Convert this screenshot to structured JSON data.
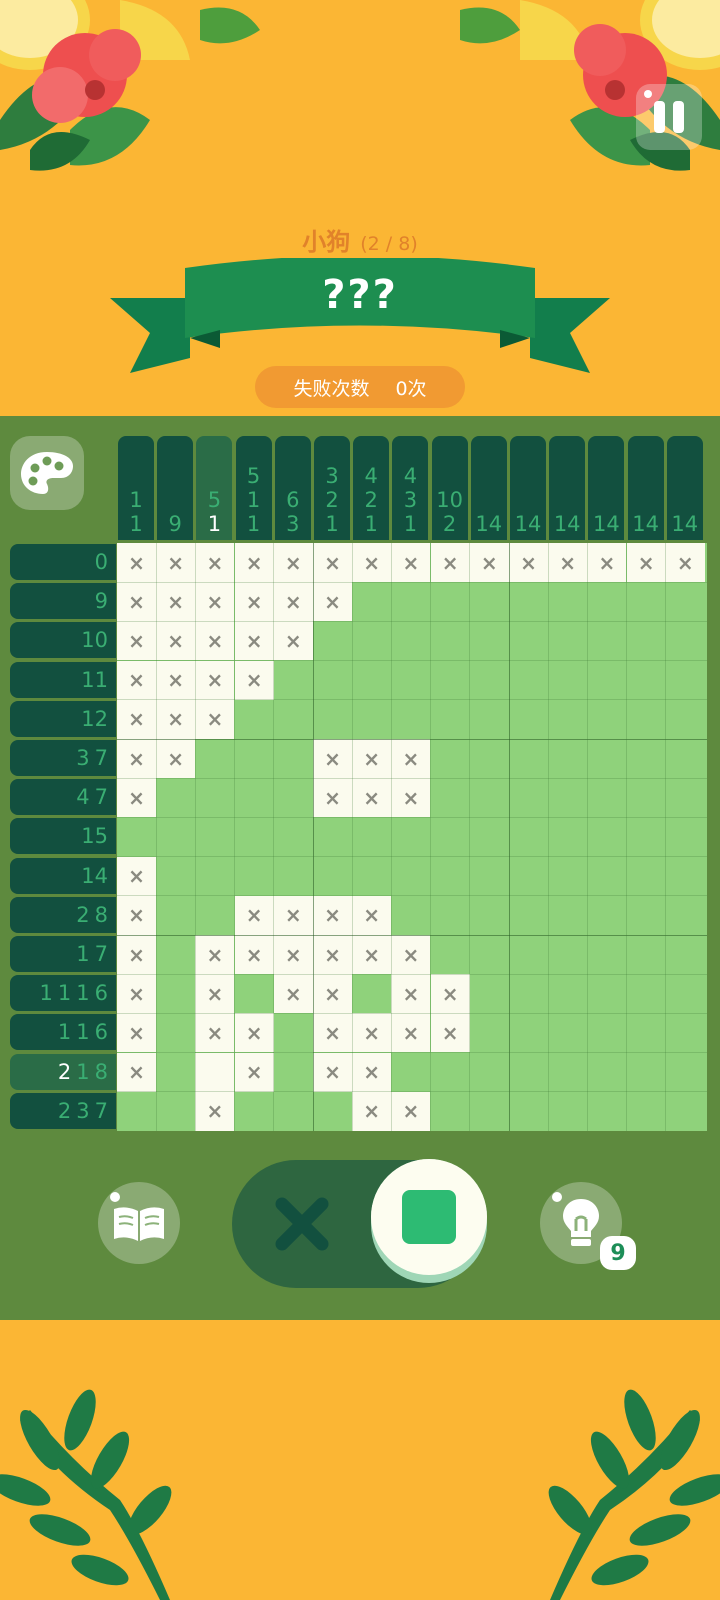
{
  "header": {
    "puzzle_name": "小狗",
    "progress": "(2 / 8)",
    "answer": "???",
    "fail_label": "失败次数",
    "fail_count": "0次"
  },
  "hint_count": "9",
  "col_clues": [
    [
      {
        "t": "1",
        "w": false
      },
      {
        "t": "1",
        "w": false
      }
    ],
    [
      {
        "t": "9",
        "w": false
      }
    ],
    [
      {
        "t": "5",
        "w": false
      },
      {
        "t": "1",
        "w": true
      }
    ],
    [
      {
        "t": "5",
        "w": false
      },
      {
        "t": "1",
        "w": false
      },
      {
        "t": "1",
        "w": false
      }
    ],
    [
      {
        "t": "6",
        "w": false
      },
      {
        "t": "3",
        "w": false
      }
    ],
    [
      {
        "t": "3",
        "w": false
      },
      {
        "t": "2",
        "w": false
      },
      {
        "t": "1",
        "w": false
      }
    ],
    [
      {
        "t": "4",
        "w": false
      },
      {
        "t": "2",
        "w": false
      },
      {
        "t": "1",
        "w": false
      }
    ],
    [
      {
        "t": "4",
        "w": false
      },
      {
        "t": "3",
        "w": false
      },
      {
        "t": "1",
        "w": false
      }
    ],
    [
      {
        "t": "10",
        "w": false
      },
      {
        "t": "2",
        "w": false
      }
    ],
    [
      {
        "t": "14",
        "w": false
      }
    ],
    [
      {
        "t": "14",
        "w": false
      }
    ],
    [
      {
        "t": "14",
        "w": false
      }
    ],
    [
      {
        "t": "14",
        "w": false
      }
    ],
    [
      {
        "t": "14",
        "w": false
      }
    ],
    [
      {
        "t": "14",
        "w": false
      }
    ]
  ],
  "highlight_col": 2,
  "row_clues": [
    [
      {
        "t": "0",
        "w": false
      }
    ],
    [
      {
        "t": "9",
        "w": false
      }
    ],
    [
      {
        "t": "10",
        "w": false
      }
    ],
    [
      {
        "t": "11",
        "w": false
      }
    ],
    [
      {
        "t": "12",
        "w": false
      }
    ],
    [
      {
        "t": "3",
        "w": false
      },
      {
        "t": "7",
        "w": false
      }
    ],
    [
      {
        "t": "4",
        "w": false
      },
      {
        "t": "7",
        "w": false
      }
    ],
    [
      {
        "t": "15",
        "w": false
      }
    ],
    [
      {
        "t": "14",
        "w": false
      }
    ],
    [
      {
        "t": "2",
        "w": false
      },
      {
        "t": "8",
        "w": false
      }
    ],
    [
      {
        "t": "1",
        "w": false
      },
      {
        "t": "7",
        "w": false
      }
    ],
    [
      {
        "t": "1",
        "w": false
      },
      {
        "t": "1",
        "w": false
      },
      {
        "t": "1",
        "w": false
      },
      {
        "t": "6",
        "w": false
      }
    ],
    [
      {
        "t": "1",
        "w": false
      },
      {
        "t": "1",
        "w": false
      },
      {
        "t": "6",
        "w": false
      }
    ],
    [
      {
        "t": "2",
        "w": true
      },
      {
        "t": "1",
        "w": false
      },
      {
        "t": "8",
        "w": false
      }
    ],
    [
      {
        "t": "2",
        "w": false
      },
      {
        "t": "3",
        "w": false
      },
      {
        "t": "7",
        "w": false
      }
    ]
  ],
  "highlight_row": 13,
  "grid": [
    "xxxxxxxxxxxxxxx",
    "xxxxxx.........",
    "xxxxx..........",
    "xxxx...........",
    "xxx............",
    "xx...xxx.......",
    "x....xxx.......",
    "...............",
    "x..............",
    "x..xxxx........",
    "x.xxxxxx.......",
    "x.x.xx.xx......",
    "x.xx.xxxx......",
    "x.ex.xx........",
    "..x...xx......."
  ],
  "icons": {
    "pause": "pause-icon",
    "palette": "palette-icon",
    "book": "book-icon",
    "hint": "lightbulb-icon",
    "cross_mode": "cross-icon",
    "fill_mode": "square-icon"
  }
}
